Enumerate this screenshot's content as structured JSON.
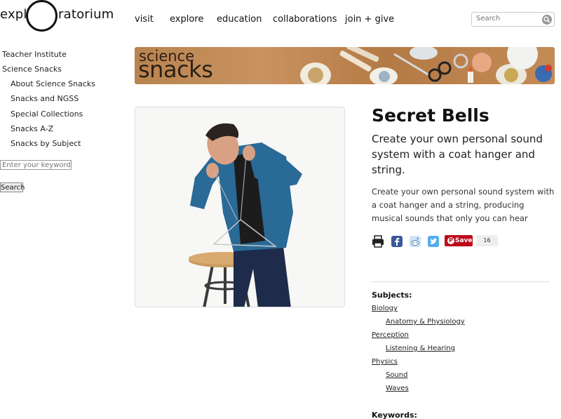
{
  "logo": {
    "left": "expl",
    "right": "ratorium"
  },
  "topnav": [
    "visit",
    "explore",
    "education",
    "collaborations",
    "join + give"
  ],
  "search": {
    "placeholder": "Search"
  },
  "sidebar": {
    "items": [
      "Teacher Institute",
      "Science Snacks",
      "About Science Snacks",
      "Snacks and NGSS",
      "Special Collections",
      "Snacks A-Z",
      "Snacks by Subject"
    ],
    "keyword_placeholder": "Enter your keywords",
    "search_button": "Search"
  },
  "banner": {
    "line1": "science",
    "line2": "snacks"
  },
  "page": {
    "title": "Secret Bells",
    "subtitle": "Create your own personal sound system with a coat hanger and string.",
    "description": "Create your own personal sound system with a coat hanger and a string, producing musical sounds that only you can hear"
  },
  "share": {
    "icons": [
      "print-icon",
      "facebook-icon",
      "reddit-icon",
      "twitter-icon"
    ],
    "pin_label": "Save",
    "pin_count": "16",
    "pin_color": "#bd081c"
  },
  "subjects": {
    "heading": "Subjects:",
    "items": [
      {
        "label": "Biology",
        "level": 0
      },
      {
        "label": "Anatomy & Physiology",
        "level": 1
      },
      {
        "label": "Perception",
        "level": 0
      },
      {
        "label": "Listening & Hearing",
        "level": 1
      },
      {
        "label": "Physics",
        "level": 0
      },
      {
        "label": "Sound",
        "level": 1
      },
      {
        "label": "Waves",
        "level": 1
      }
    ]
  },
  "keywords": {
    "heading": "Keywords:"
  }
}
